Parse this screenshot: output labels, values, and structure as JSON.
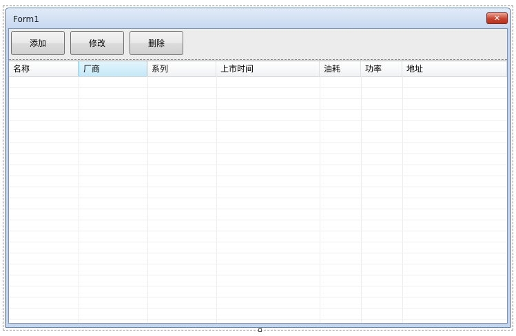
{
  "window": {
    "title": "Form1",
    "close_glyph": "✕"
  },
  "toolbar": {
    "add_label": "添加",
    "edit_label": "修改",
    "delete_label": "删除"
  },
  "grid": {
    "columns": [
      "名称",
      "厂商",
      "系列",
      "上市时间",
      "油耗",
      "功率",
      "地址"
    ],
    "active_column": "厂商",
    "rows": []
  },
  "colors": {
    "title_bar": "#c7d8ef",
    "close_button": "#c8432f",
    "active_header": "#c5e8f7"
  }
}
